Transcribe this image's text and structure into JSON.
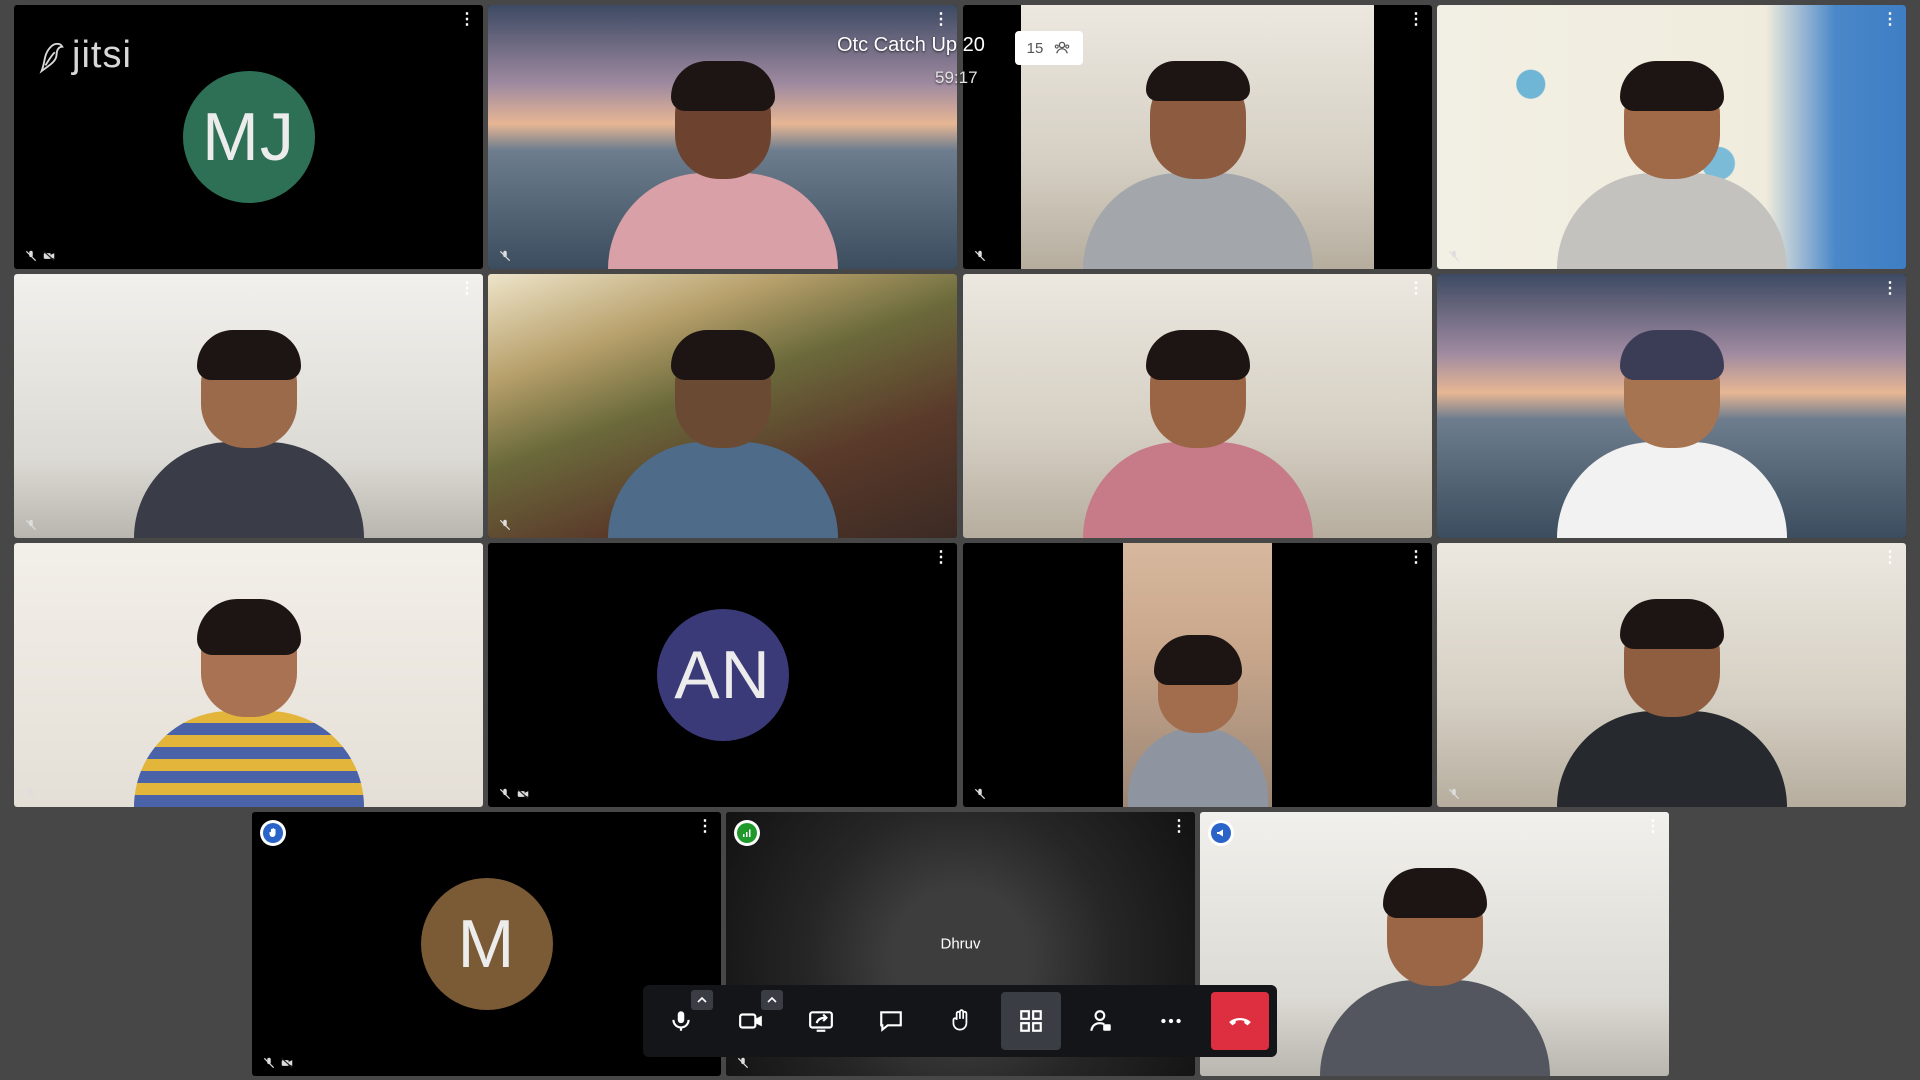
{
  "meeting": {
    "title": "Otc Catch Up 20",
    "timer": "59:17",
    "participant_count": "15"
  },
  "logo": {
    "text": "jitsi"
  },
  "tiles": [
    {
      "id": "mj",
      "kind": "avatar",
      "initials": "MJ",
      "avatar_color": "#2d7055",
      "mic_muted": true,
      "video_off": true
    },
    {
      "id": "p2",
      "kind": "video",
      "scene": "city",
      "mic_muted": true
    },
    {
      "id": "p3",
      "kind": "video",
      "scene": "room",
      "mic_muted": true
    },
    {
      "id": "p4",
      "kind": "video",
      "scene": "curtain",
      "mic_muted": true
    },
    {
      "id": "p5",
      "kind": "video",
      "scene": "wall-light",
      "mic_muted": true
    },
    {
      "id": "p6",
      "kind": "video",
      "scene": "balcony",
      "mic_muted": true
    },
    {
      "id": "p7",
      "kind": "video",
      "scene": "room"
    },
    {
      "id": "p8",
      "kind": "video",
      "scene": "city"
    },
    {
      "id": "p9",
      "kind": "video",
      "scene": "wall-warm",
      "mic_muted": true
    },
    {
      "id": "an",
      "kind": "avatar",
      "initials": "AN",
      "avatar_color": "#3a3a78",
      "mic_muted": true,
      "video_off": true
    },
    {
      "id": "p11",
      "kind": "video",
      "scene": "portrait",
      "mic_muted": true
    },
    {
      "id": "p12",
      "kind": "video",
      "scene": "room",
      "mic_muted": true
    },
    {
      "id": "m",
      "kind": "avatar",
      "initials": "M",
      "avatar_color": "#7b5a36",
      "mic_muted": true,
      "video_off": true,
      "indicator": "raised-hand"
    },
    {
      "id": "dhruv",
      "kind": "video",
      "scene": "dim",
      "name": "Dhruv",
      "indicator": "connection-good",
      "mic_muted": true
    },
    {
      "id": "p15",
      "kind": "video",
      "scene": "wall-light",
      "active": true,
      "indicator": "dominant-speaker"
    }
  ],
  "toolbar": {
    "items": [
      "microphone",
      "camera",
      "share-screen",
      "chat",
      "raise-hand",
      "tile-view",
      "participants",
      "more",
      "leave"
    ]
  },
  "colors": {
    "background": "#474747",
    "hangup": "#dd2f3f",
    "active_border": "#2f6fd6",
    "connection_good": "#1f9a2a",
    "indicator_blue": "#2a64c9"
  }
}
